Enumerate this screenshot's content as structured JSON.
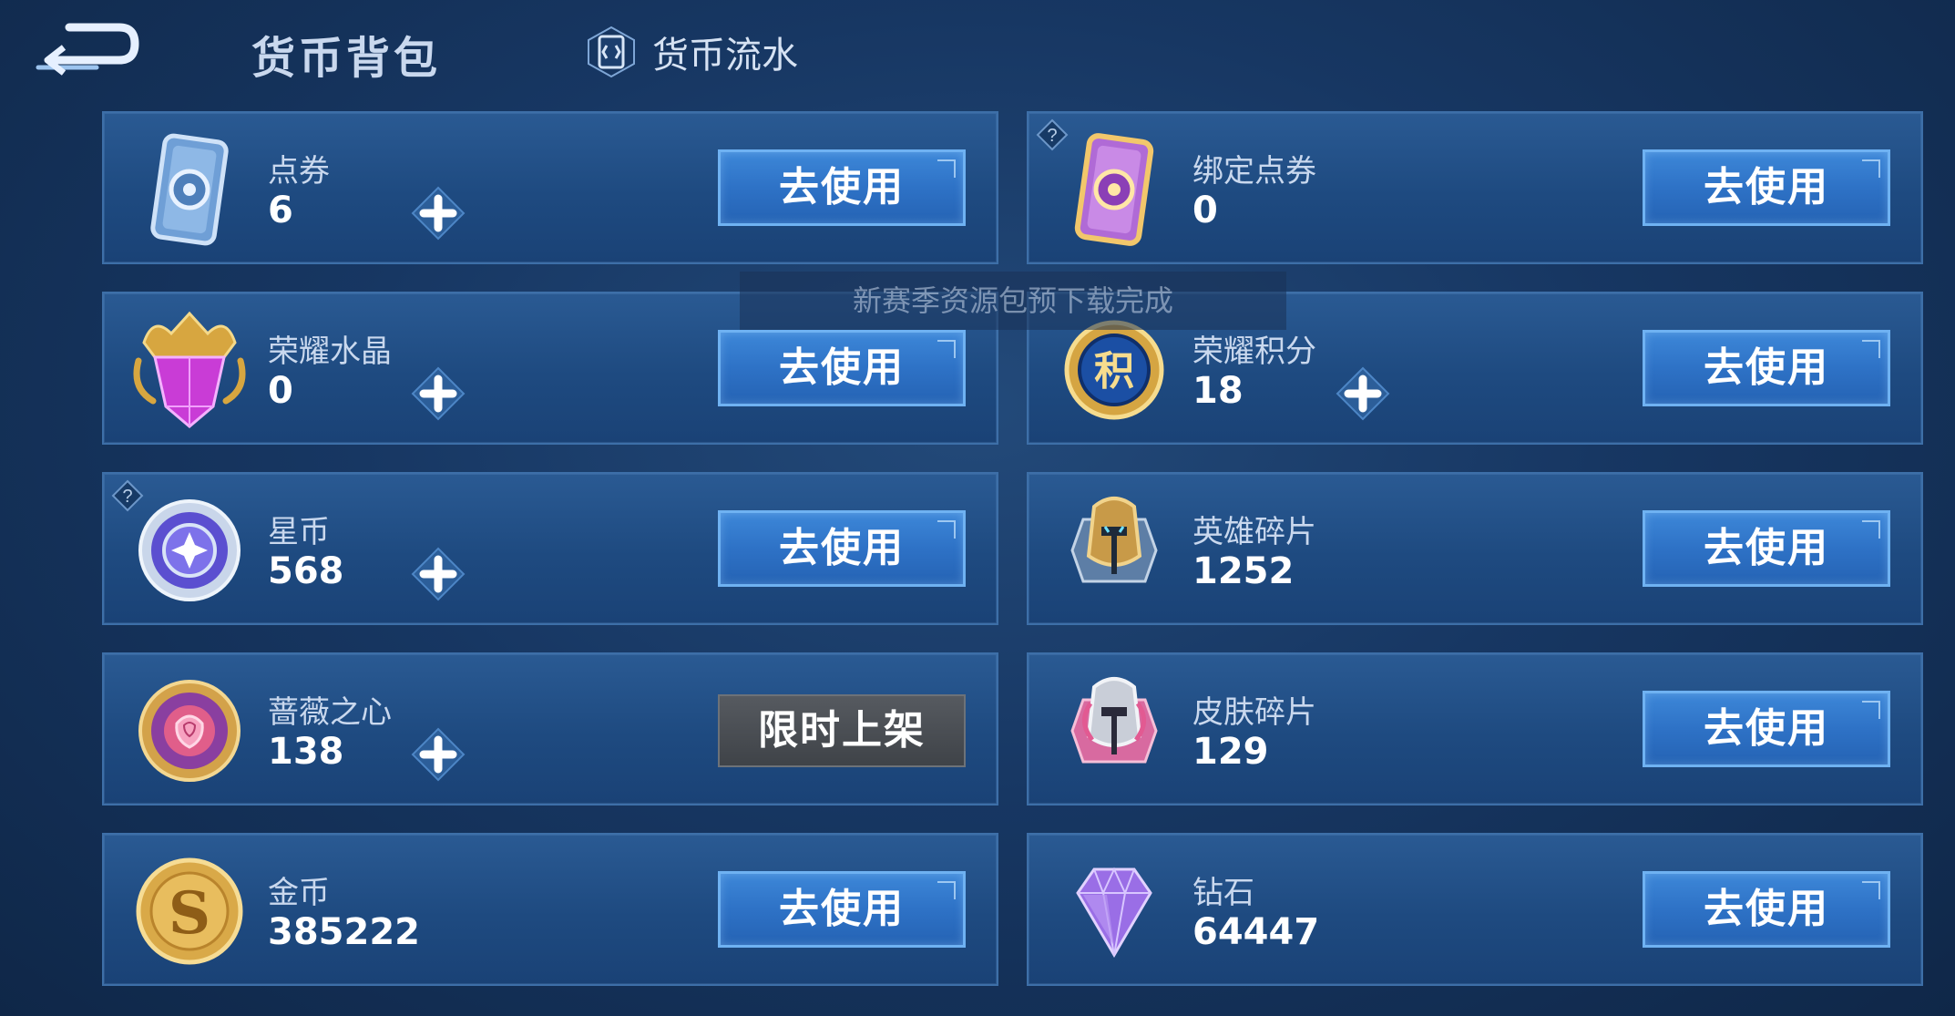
{
  "header": {
    "title": "货币背包",
    "flow_link": "货币流水"
  },
  "toast": "新赛季资源包预下载完成",
  "currencies": [
    {
      "name": "点券",
      "amount": "6",
      "button": "去使用",
      "icon": "coupon-icon"
    },
    {
      "name": "绑定点券",
      "amount": "0",
      "button": "去使用",
      "icon": "bound-coupon-icon"
    },
    {
      "name": "荣耀水晶",
      "amount": "0",
      "button": "去使用",
      "icon": "glory-crystal-icon"
    },
    {
      "name": "荣耀积分",
      "amount": "18",
      "button": "去使用",
      "icon": "glory-points-icon"
    },
    {
      "name": "星币",
      "amount": "568",
      "button": "去使用",
      "icon": "star-coin-icon"
    },
    {
      "name": "英雄碎片",
      "amount": "1252",
      "button": "去使用",
      "icon": "hero-fragment-icon"
    },
    {
      "name": "蔷薇之心",
      "amount": "138",
      "button": "限时上架",
      "icon": "rose-heart-icon"
    },
    {
      "name": "皮肤碎片",
      "amount": "129",
      "button": "去使用",
      "icon": "skin-fragment-icon"
    },
    {
      "name": "金币",
      "amount": "385222",
      "button": "去使用",
      "icon": "gold-coin-icon"
    },
    {
      "name": "钻石",
      "amount": "64447",
      "button": "去使用",
      "icon": "diamond-icon"
    }
  ],
  "colors": {
    "background": "#173763",
    "button_blue": "#2e72c6",
    "button_gray": "#4a4e54"
  }
}
